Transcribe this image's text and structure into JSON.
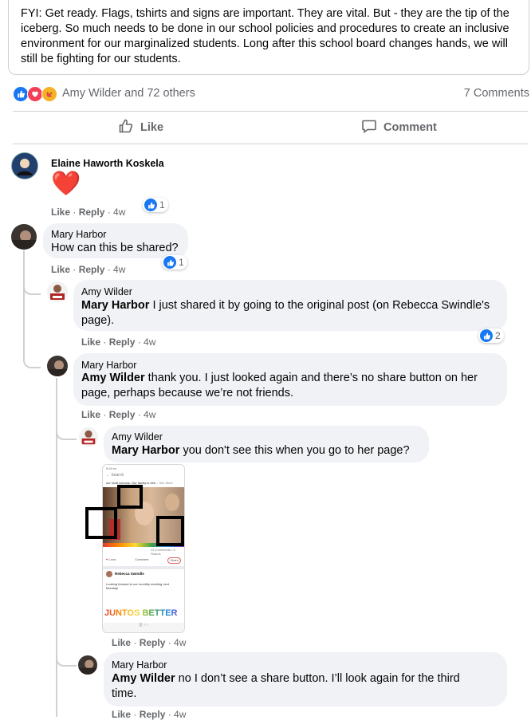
{
  "post": {
    "text": "FYI: Get ready. Flags, tshirts and signs are important. They are vital. But - they are the tip of the iceberg. So much needs to be done in our school policies and procedures to create an inclusive environment for our marginalized students. Long after this school board changes hands, we will still be fighting for our students."
  },
  "reactions": {
    "names": "Amy Wilder and 72 others",
    "comments_count": "7 Comments",
    "icons": [
      "like-icon",
      "love-icon",
      "care-icon"
    ]
  },
  "actions": {
    "like": "Like",
    "comment": "Comment"
  },
  "comments": [
    {
      "name": "Elaine Haworth Koskela",
      "text": "❤️",
      "like": "Like",
      "reply": "Reply",
      "time": "4w",
      "reactions": "1"
    },
    {
      "name": "Mary Harbor",
      "text": "How can this be shared?",
      "like": "Like",
      "reply": "Reply",
      "time": "4w",
      "reactions": "1"
    },
    {
      "name": "Amy Wilder",
      "tag": "Mary Harbor",
      "text": " I just shared it by going to the original post (on Rebecca Swindle's page).",
      "like": "Like",
      "reply": "Reply",
      "time": "4w",
      "reactions": "2"
    },
    {
      "name": "Mary Harbor",
      "tag": "Amy Wilder",
      "text": " thank you. I just looked again and there’s no share button on her page, perhaps because we’re not friends.",
      "like": "Like",
      "reply": "Reply",
      "time": "4w"
    },
    {
      "name": "Amy Wilder",
      "tag": "Mary Harbor",
      "text": " you don't see this when you go to her page?",
      "like": "Like",
      "reply": "Reply",
      "time": "4w"
    },
    {
      "name": "Mary Harbor",
      "tag": "Amy Wilder",
      "text": " no I don’t see a share button. I’ll look again for the third time.",
      "like": "Like",
      "reply": "Reply",
      "time": "4w"
    }
  ],
  "attachment": {
    "search": "Search",
    "post_snippet": "our local schools. Our family is dee...",
    "see_more": "See More",
    "counts": "23 Comments • 4 Shares",
    "love": "Love",
    "comment": "Comment",
    "share": "Share",
    "author": "Rebecca Swindle",
    "body": "Looking forward to our monthly meeting next Monday!",
    "banner": "JUNTOS BETTER"
  }
}
